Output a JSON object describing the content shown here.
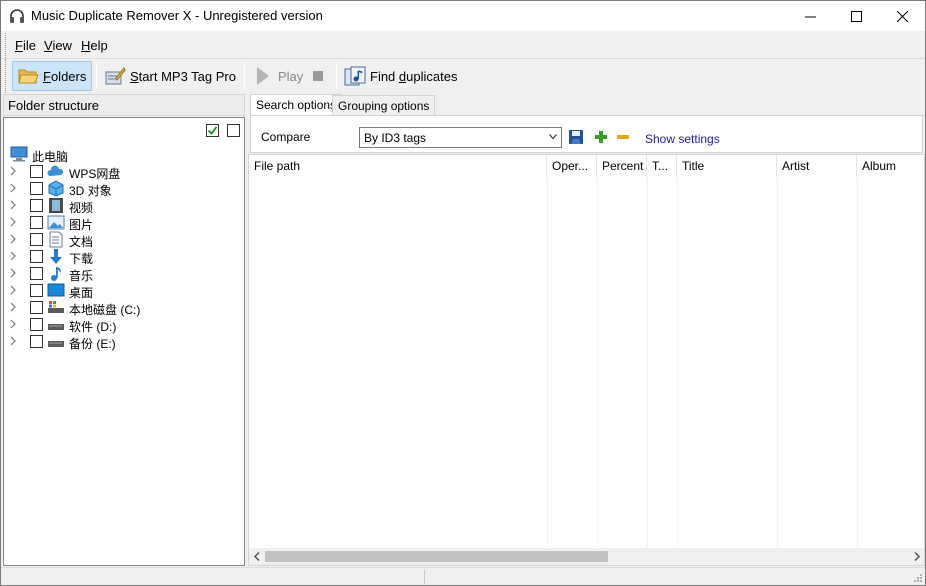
{
  "window": {
    "title": "Music Duplicate Remover X - Unregistered version"
  },
  "menu": {
    "file": {
      "accel": "F",
      "rest": "ile"
    },
    "view": {
      "accel": "V",
      "rest": "iew"
    },
    "help": {
      "accel": "H",
      "rest": "elp"
    }
  },
  "toolbar": {
    "folders": {
      "accel": "F",
      "rest": "olders",
      "icon": "folder-open-icon",
      "active": true
    },
    "start_tag_pro": {
      "accel": "S",
      "rest": "tart MP3 Tag Pro",
      "icon": "tag-pen-icon"
    },
    "play": {
      "label": "Play",
      "icon": "play-icon",
      "disabled": true
    },
    "stop": {
      "icon": "stop-icon",
      "disabled": true
    },
    "find_duplicates": {
      "before": "Find ",
      "accel": "d",
      "rest": "uplicates",
      "icon": "music-search-icon"
    }
  },
  "left_panel": {
    "header": "Folder structure",
    "check_all_checked": true,
    "check_none_checked": false,
    "root": {
      "label": "此电脑",
      "icon": "computer-icon"
    },
    "items": [
      {
        "label": "WPS网盘",
        "icon": "cloud-icon"
      },
      {
        "label": "3D 对象",
        "icon": "3d-objects-icon"
      },
      {
        "label": "视频",
        "icon": "video-icon"
      },
      {
        "label": "图片",
        "icon": "pictures-icon"
      },
      {
        "label": "文档",
        "icon": "documents-icon"
      },
      {
        "label": "下载",
        "icon": "download-icon"
      },
      {
        "label": "音乐",
        "icon": "music-icon"
      },
      {
        "label": "桌面",
        "icon": "desktop-icon"
      },
      {
        "label": "本地磁盘 (C:)",
        "icon": "system-drive-icon"
      },
      {
        "label": "软件 (D:)",
        "icon": "drive-icon"
      },
      {
        "label": "备份 (E:)",
        "icon": "drive-icon"
      }
    ]
  },
  "right_panel": {
    "tabs": [
      {
        "label": "Search options",
        "selected": true
      },
      {
        "label": "Grouping options",
        "selected": false
      }
    ],
    "compare_label": "Compare",
    "compare_value": "By ID3 tags",
    "show_settings": "Show settings",
    "columns": [
      "File path",
      "Oper...",
      "Percent",
      "T...",
      "Title",
      "Artist",
      "Album"
    ]
  },
  "colors": {
    "accent_selected": "#cce4f7",
    "link": "#1a1aa6",
    "save_icon": "#1f4e9a",
    "add_icon": "#3a9a2a",
    "remove_icon": "#e8a21c"
  }
}
